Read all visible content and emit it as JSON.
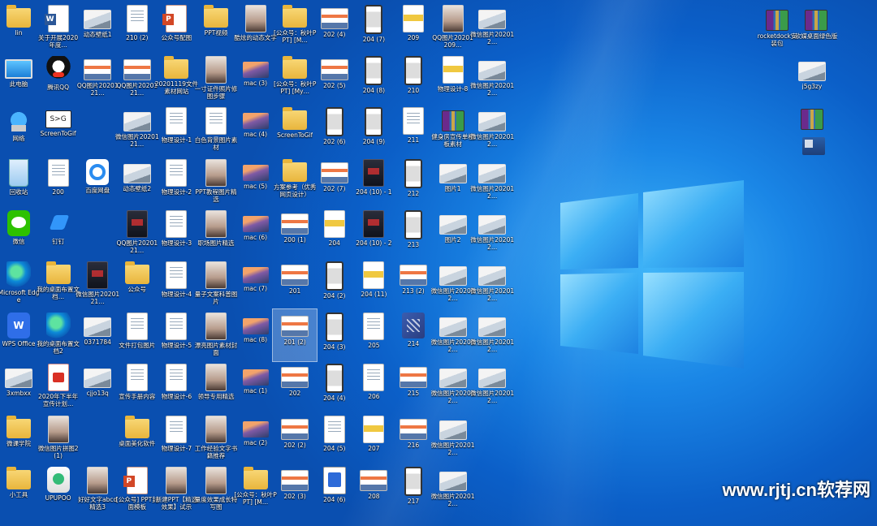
{
  "desktop": {
    "watermark": "www.rjtj.cn软荐网",
    "icons": [
      {
        "label": "lin",
        "kind": "folder"
      },
      {
        "label": "关于开展2020年度…",
        "kind": "word"
      },
      {
        "label": "动态壁纸1",
        "kind": "img"
      },
      {
        "label": "210 (2)",
        "kind": "doc"
      },
      {
        "label": "公众号配图",
        "kind": "ppt"
      },
      {
        "label": "PPT视频",
        "kind": "folder"
      },
      {
        "label": "酷炫的动态文字",
        "kind": "photo"
      },
      {
        "label": "[公众号：秋叶PPT] [M…",
        "kind": "folder"
      },
      {
        "label": "202 (4)",
        "kind": "slide"
      },
      {
        "label": "204 (7)",
        "kind": "phone"
      },
      {
        "label": "209",
        "kind": "poster"
      },
      {
        "label": "QQ图片20201209…",
        "kind": "photo"
      },
      {
        "label": "微信图片202012…",
        "kind": "img"
      },
      {
        "label": "此电脑",
        "kind": "thispc"
      },
      {
        "label": "腾讯QQ",
        "kind": "qq"
      },
      {
        "label": "QQ图片2020121…",
        "kind": "slide"
      },
      {
        "label": "QQ图片2020121…",
        "kind": "slide"
      },
      {
        "label": "20201119文件素材网站",
        "kind": "folder"
      },
      {
        "label": "一寸证件照片修图步骤",
        "kind": "photo"
      },
      {
        "label": "mac (3)",
        "kind": "mac"
      },
      {
        "label": "[公众号：秋叶PPT] [My…",
        "kind": "folder"
      },
      {
        "label": "202 (5)",
        "kind": "slide"
      },
      {
        "label": "204 (8)",
        "kind": "phone"
      },
      {
        "label": "210",
        "kind": "phone"
      },
      {
        "label": "物理设计-8",
        "kind": "poster"
      },
      {
        "label": "微信图片202012…",
        "kind": "img"
      },
      {
        "label": "网络",
        "kind": "net"
      },
      {
        "label": "ScreenToGif",
        "kind": "s2g"
      },
      {
        "label": "",
        "kind": "none"
      },
      {
        "label": "微信图片2020121…",
        "kind": "img"
      },
      {
        "label": "物理设计-1",
        "kind": "doc"
      },
      {
        "label": "白色背景图片素材",
        "kind": "doc"
      },
      {
        "label": "mac (4)",
        "kind": "mac"
      },
      {
        "label": "ScreenToGif",
        "kind": "folder"
      },
      {
        "label": "202 (6)",
        "kind": "phone"
      },
      {
        "label": "204 (9)",
        "kind": "phone"
      },
      {
        "label": "211",
        "kind": "doc"
      },
      {
        "label": "健身房宣传单模板素材",
        "kind": "rar"
      },
      {
        "label": "微信图片202012…",
        "kind": "img"
      },
      {
        "label": "回收站",
        "kind": "bin"
      },
      {
        "label": "200",
        "kind": "doc"
      },
      {
        "label": "百度网盘",
        "kind": "baidu"
      },
      {
        "label": "动态壁纸2",
        "kind": "img"
      },
      {
        "label": "物理设计-2",
        "kind": "doc"
      },
      {
        "label": "PPT教程图片精选",
        "kind": "photo"
      },
      {
        "label": "mac (5)",
        "kind": "mac"
      },
      {
        "label": "方案参考（优秀网页设计）",
        "kind": "folder"
      },
      {
        "label": "202 (7)",
        "kind": "slide"
      },
      {
        "label": "204 (10) - 1",
        "kind": "dark"
      },
      {
        "label": "212",
        "kind": "phone"
      },
      {
        "label": "图片1",
        "kind": "img"
      },
      {
        "label": "微信图片202012…",
        "kind": "img"
      },
      {
        "label": "微信",
        "kind": "wechat"
      },
      {
        "label": "钉钉",
        "kind": "ding"
      },
      {
        "label": "",
        "kind": "none"
      },
      {
        "label": "QQ图片2020121…",
        "kind": "dark"
      },
      {
        "label": "物理设计-3",
        "kind": "doc"
      },
      {
        "label": "职场图片精选",
        "kind": "photo"
      },
      {
        "label": "mac (6)",
        "kind": "mac"
      },
      {
        "label": "200 (1)",
        "kind": "slide"
      },
      {
        "label": "204",
        "kind": "poster"
      },
      {
        "label": "204 (10) - 2",
        "kind": "dark"
      },
      {
        "label": "213",
        "kind": "phone"
      },
      {
        "label": "图片2",
        "kind": "img"
      },
      {
        "label": "微信图片202012…",
        "kind": "img"
      },
      {
        "label": "Microsoft Edge",
        "kind": "edge"
      },
      {
        "label": "我的桌面布置文档…",
        "kind": "folder"
      },
      {
        "label": "微信图片2020121…",
        "kind": "dark"
      },
      {
        "label": "公众号",
        "kind": "folder"
      },
      {
        "label": "物理设计-4",
        "kind": "doc"
      },
      {
        "label": "量子文案科普图片",
        "kind": "photo"
      },
      {
        "label": "mac (7)",
        "kind": "mac"
      },
      {
        "label": "201",
        "kind": "slide"
      },
      {
        "label": "204 (2)",
        "kind": "phone"
      },
      {
        "label": "204 (11)",
        "kind": "poster"
      },
      {
        "label": "213 (2)",
        "kind": "slide"
      },
      {
        "label": "微信图片202012…",
        "kind": "img"
      },
      {
        "label": "微信图片202012…",
        "kind": "img"
      },
      {
        "label": "WPS Office",
        "kind": "wps"
      },
      {
        "label": "我的桌面布置文档2",
        "kind": "edge"
      },
      {
        "label": "0371784",
        "kind": "img"
      },
      {
        "label": "文件打包图片",
        "kind": "doc"
      },
      {
        "label": "物理设计-5",
        "kind": "doc"
      },
      {
        "label": "漂亮图片素材封面",
        "kind": "photo"
      },
      {
        "label": "mac (8)",
        "kind": "mac"
      },
      {
        "label": "201 (2)",
        "kind": "slide",
        "selected": true
      },
      {
        "label": "204 (3)",
        "kind": "phone"
      },
      {
        "label": "205",
        "kind": "doc"
      },
      {
        "label": "214",
        "kind": "tile"
      },
      {
        "label": "微信图片202012…",
        "kind": "img"
      },
      {
        "label": "微信图片202012…",
        "kind": "img"
      },
      {
        "label": "3xmbxx",
        "kind": "img"
      },
      {
        "label": "2020年下半年宣传计划…",
        "kind": "pdf"
      },
      {
        "label": "cjjo13q",
        "kind": "img"
      },
      {
        "label": "宣传手册内容",
        "kind": "doc"
      },
      {
        "label": "物理设计-6",
        "kind": "doc"
      },
      {
        "label": "领导专用精选",
        "kind": "photo"
      },
      {
        "label": "mac (1)",
        "kind": "mac"
      },
      {
        "label": "202",
        "kind": "slide"
      },
      {
        "label": "204 (4)",
        "kind": "phone"
      },
      {
        "label": "206",
        "kind": "doc"
      },
      {
        "label": "215",
        "kind": "slide"
      },
      {
        "label": "微信图片202012…",
        "kind": "img"
      },
      {
        "label": "微信图片202012…",
        "kind": "img"
      },
      {
        "label": "微课学院",
        "kind": "folder"
      },
      {
        "label": "微信图片拼图2(1)",
        "kind": "photo"
      },
      {
        "label": "",
        "kind": "none"
      },
      {
        "label": "桌面美化软件",
        "kind": "folder"
      },
      {
        "label": "物理设计-7",
        "kind": "doc"
      },
      {
        "label": "工作经验文字书籍推荐",
        "kind": "photo"
      },
      {
        "label": "mac (2)",
        "kind": "mac"
      },
      {
        "label": "202 (2)",
        "kind": "slide"
      },
      {
        "label": "204 (5)",
        "kind": "doc"
      },
      {
        "label": "207",
        "kind": "poster"
      },
      {
        "label": "216",
        "kind": "slide"
      },
      {
        "label": "微信图片202012…",
        "kind": "img"
      },
      {
        "label": "",
        "kind": "none"
      },
      {
        "label": "小工具",
        "kind": "folder"
      },
      {
        "label": "UPUPOO",
        "kind": "app"
      },
      {
        "label": "好好文字abcd精选3",
        "kind": "photo"
      },
      {
        "label": "[公众号] PPT封面模板",
        "kind": "ppt"
      },
      {
        "label": "新建PPT【精选效果】试示",
        "kind": "photo"
      },
      {
        "label": "量度效果成长特写图",
        "kind": "photo"
      },
      {
        "label": "[公众号：秋叶PPT] [M…",
        "kind": "folder"
      },
      {
        "label": "202 (3)",
        "kind": "slide"
      },
      {
        "label": "204 (6)",
        "kind": "card"
      },
      {
        "label": "208",
        "kind": "slide"
      },
      {
        "label": "217",
        "kind": "phone"
      },
      {
        "label": "微信图片202012…",
        "kind": "img"
      },
      {
        "label": "",
        "kind": "none"
      }
    ],
    "right_icons": [
      {
        "label": "rocketdock安装包",
        "kind": "rar"
      },
      {
        "label": "软媒桌面绿色版",
        "kind": "rar"
      },
      {
        "label": "j5g3zy",
        "kind": "img"
      },
      {
        "label": "",
        "kind": "rar"
      },
      {
        "label": "",
        "kind": "clip"
      }
    ]
  }
}
